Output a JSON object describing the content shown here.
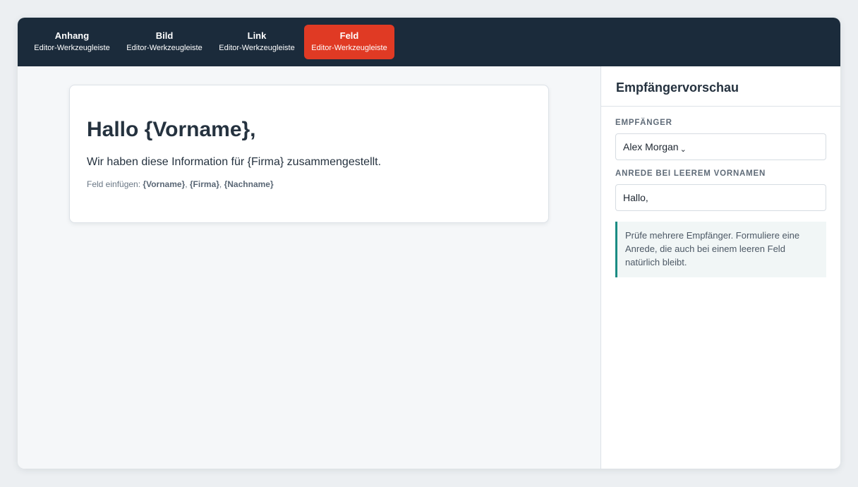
{
  "toolbar": {
    "tools": [
      {
        "title": "Anhang",
        "subtitle": "Editor-Werkzeugleiste"
      },
      {
        "title": "Bild",
        "subtitle": "Editor-Werkzeugleiste"
      },
      {
        "title": "Link",
        "subtitle": "Editor-Werkzeugleiste"
      },
      {
        "title": "Feld",
        "subtitle": "Editor-Werkzeugleiste"
      }
    ],
    "active_tool": "Feld",
    "colors": {
      "background": "#1b2b3b",
      "active": "#e03a24"
    }
  },
  "editor": {
    "greeting": "Hallo {Vorname},",
    "body": "Wir haben diese Information für {Firma} zusammengestellt.",
    "insert_label": "Feld einfügen:",
    "tokens": [
      "{Vorname}",
      "{Firma}",
      "{Nachname}"
    ]
  },
  "sidebar": {
    "title": "Empfängervorschau",
    "recipient_label": "EMPFÄNGER",
    "recipient_value": "Alex Morgan",
    "salutation_label": "ANREDE BEI LEEREM VORNAMEN",
    "salutation_value": "Hallo,",
    "hint": "Prüfe mehrere Empfänger. Formuliere eine Anrede, die auch bei einem leeren Feld natürlich bleibt.",
    "hint_accent_color": "#1a8c83"
  },
  "icons": {
    "dropdown": "chevron-down-icon"
  }
}
